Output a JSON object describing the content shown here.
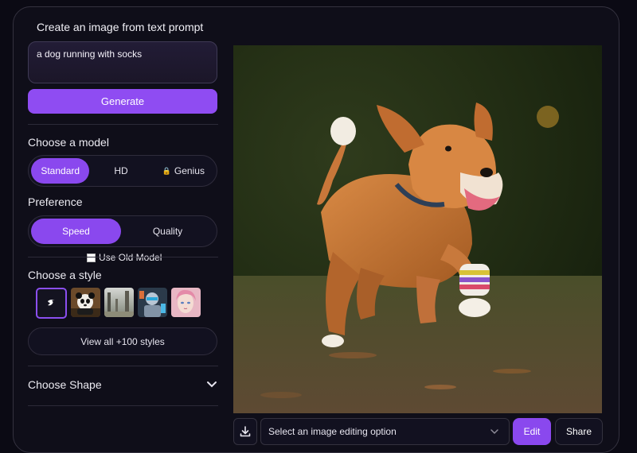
{
  "header": {
    "title": "Create an image from text prompt"
  },
  "prompt": {
    "value": "a dog running with socks"
  },
  "generate": {
    "label": "Generate"
  },
  "model": {
    "label": "Choose a model",
    "options": [
      "Standard",
      "HD",
      "Genius"
    ],
    "selected": "Standard",
    "locked": [
      "Genius"
    ]
  },
  "preference": {
    "label": "Preference",
    "options": [
      "Speed",
      "Quality"
    ],
    "selected": "Speed"
  },
  "old_model": {
    "label": "Use Old Model",
    "checked": false
  },
  "style": {
    "label": "Choose a style",
    "thumbnails": [
      "none-style-icon",
      "panda-style",
      "landscape-style",
      "robot-style",
      "portrait-style"
    ],
    "selected": "none-style-icon",
    "view_all_label": "View all +100 styles"
  },
  "shape": {
    "label": "Choose Shape"
  },
  "toolbar": {
    "select_placeholder": "Select an image editing option",
    "edit_label": "Edit",
    "share_label": "Share"
  },
  "colors": {
    "accent": "#8a48ee",
    "background": "#0b0a14"
  }
}
